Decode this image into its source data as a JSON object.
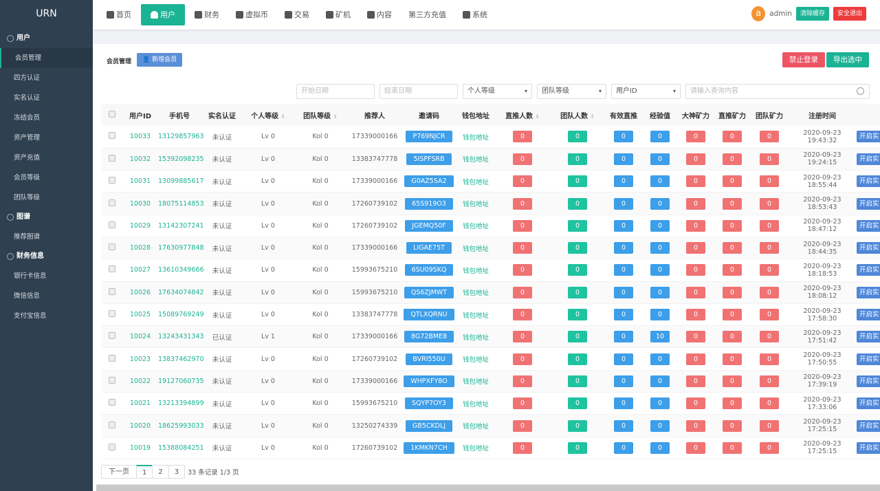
{
  "app": {
    "logo": "URN"
  },
  "sidebar": {
    "sections": [
      {
        "label": "用户",
        "items": [
          "会员管理",
          "四方认证",
          "实名认证",
          "冻结会员",
          "资产管理",
          "资产充值",
          "会员等级",
          "团队等级"
        ]
      },
      {
        "label": "图谱",
        "items": [
          "推荐图谱"
        ]
      },
      {
        "label": "财务信息",
        "items": [
          "银行卡信息",
          "微信信息",
          "支付宝信息"
        ]
      }
    ],
    "active": "会员管理"
  },
  "topnav": {
    "items": [
      {
        "label": "首页",
        "icon": "home-icon"
      },
      {
        "label": "用户",
        "icon": "user-icon"
      },
      {
        "label": "财务",
        "icon": "yen-icon"
      },
      {
        "label": "虚拟币",
        "icon": "database-icon"
      },
      {
        "label": "交易",
        "icon": "exchange-icon"
      },
      {
        "label": "矿机",
        "icon": "server-icon"
      },
      {
        "label": "内容",
        "icon": "document-icon"
      },
      {
        "label": "第三方充值",
        "icon": ""
      },
      {
        "label": "系统",
        "icon": "gear-icon"
      }
    ],
    "active": "用户"
  },
  "user": {
    "avatar": "a",
    "name": "admin",
    "clear_cache": "清除缓存",
    "logout": "安全退出"
  },
  "page": {
    "title": "会员管理",
    "add_button": "新增会员",
    "ban_button": "禁止登录",
    "export_button": "导出选中"
  },
  "filters": {
    "start_date": "开始日期",
    "end_date": "结束日期",
    "personal_level": "个人等级",
    "team_level": "团队等级",
    "field": "用户ID",
    "search_placeholder": "请输入查询内容"
  },
  "table": {
    "headers": [
      "用户ID",
      "手机号",
      "实名认证",
      "个人等级",
      "团队等级",
      "推荐人",
      "邀请码",
      "钱包地址",
      "直推人数",
      "团队人数",
      "有效直推",
      "经验值",
      "大神矿力",
      "直推矿力",
      "团队矿力",
      "注册时间",
      ""
    ],
    "rows": [
      [
        "10033",
        "13129857963",
        "未认证",
        "Lv 0",
        "Kol 0",
        "17339000166",
        "P769NJCR",
        "钱包地址",
        "0",
        "0",
        "0",
        "0",
        "0",
        "0",
        "0",
        "2020-09-23 19:43:32",
        "开启实"
      ],
      [
        "10032",
        "15392098235",
        "未认证",
        "Lv 0",
        "Kol 0",
        "13383747778",
        "5ISPFSRB",
        "钱包地址",
        "0",
        "0",
        "0",
        "0",
        "0",
        "0",
        "0",
        "2020-09-23 19:24:15",
        "开启实"
      ],
      [
        "10031",
        "13099885617",
        "未认证",
        "Lv 0",
        "Kol 0",
        "17339000166",
        "G0AZ5SA2",
        "钱包地址",
        "0",
        "0",
        "0",
        "0",
        "0",
        "0",
        "0",
        "2020-09-23 18:55:44",
        "开启实"
      ],
      [
        "10030",
        "18075114853",
        "未认证",
        "Lv 0",
        "Kol 0",
        "17260739102",
        "65S919O3",
        "钱包地址",
        "0",
        "0",
        "0",
        "0",
        "0",
        "0",
        "0",
        "2020-09-23 18:53:43",
        "开启实"
      ],
      [
        "10029",
        "13142307241",
        "未认证",
        "Lv 0",
        "Kol 0",
        "17260739102",
        "JGEMQ50F",
        "钱包地址",
        "0",
        "0",
        "0",
        "0",
        "0",
        "0",
        "0",
        "2020-09-23 18:47:12",
        "开启实"
      ],
      [
        "10028",
        "17630977848",
        "未认证",
        "Lv 0",
        "Kol 0",
        "17339000166",
        "LIGAE75T",
        "钱包地址",
        "0",
        "0",
        "0",
        "0",
        "0",
        "0",
        "0",
        "2020-09-23 18:44:35",
        "开启实"
      ],
      [
        "10027",
        "13610349666",
        "未认证",
        "Lv 0",
        "Kol 0",
        "15993675210",
        "6SU09SKQ",
        "钱包地址",
        "0",
        "0",
        "0",
        "0",
        "0",
        "0",
        "0",
        "2020-09-23 18:18:53",
        "开启实"
      ],
      [
        "10026",
        "17634074842",
        "未认证",
        "Lv 0",
        "Kol 0",
        "15993675210",
        "QS6ZJMWT",
        "钱包地址",
        "0",
        "0",
        "0",
        "0",
        "0",
        "0",
        "0",
        "2020-09-23 18:08:12",
        "开启实"
      ],
      [
        "10025",
        "15089769249",
        "未认证",
        "Lv 0",
        "Kol 0",
        "13383747778",
        "QTLXQRNU",
        "钱包地址",
        "0",
        "0",
        "0",
        "0",
        "0",
        "0",
        "0",
        "2020-09-23 17:58:30",
        "开启实"
      ],
      [
        "10024",
        "13243431343",
        "已认证",
        "Lv 1",
        "Kol 0",
        "17339000166",
        "8G72BME8",
        "钱包地址",
        "0",
        "0",
        "0",
        "10",
        "0",
        "0",
        "0",
        "2020-09-23 17:51:42",
        "开启实"
      ],
      [
        "10023",
        "13837462970",
        "未认证",
        "Lv 0",
        "Kol 0",
        "17260739102",
        "BVRI550U",
        "钱包地址",
        "0",
        "0",
        "0",
        "0",
        "0",
        "0",
        "0",
        "2020-09-23 17:50:55",
        "开启实"
      ],
      [
        "10022",
        "19127060735",
        "未认证",
        "Lv 0",
        "Kol 0",
        "17339000166",
        "WHPXFY8O",
        "钱包地址",
        "0",
        "0",
        "0",
        "0",
        "0",
        "0",
        "0",
        "2020-09-23 17:39:19",
        "开启实"
      ],
      [
        "10021",
        "13213394899",
        "未认证",
        "Lv 0",
        "Kol 0",
        "15993675210",
        "SQYP7OY3",
        "钱包地址",
        "0",
        "0",
        "0",
        "0",
        "0",
        "0",
        "0",
        "2020-09-23 17:33:06",
        "开启实"
      ],
      [
        "10020",
        "18625993033",
        "未认证",
        "Lv 0",
        "Kol 0",
        "13250274339",
        "GB5CKDLJ",
        "钱包地址",
        "0",
        "0",
        "0",
        "0",
        "0",
        "0",
        "0",
        "2020-09-23 17:25:15",
        "开启实"
      ],
      [
        "10019",
        "15388084251",
        "未认证",
        "Lv 0",
        "Kol 0",
        "17260739102",
        "1KMKN7CH",
        "钱包地址",
        "0",
        "0",
        "0",
        "0",
        "0",
        "0",
        "0",
        "2020-09-23 17:25:15",
        "开启实"
      ]
    ]
  },
  "pagination": {
    "next": "下一页",
    "pages": [
      "1",
      "2",
      "3"
    ],
    "current": "1",
    "info": "33 条记录 1/3 页"
  },
  "colors": {
    "accent": "#1ab394",
    "blue": "#3d9ee9",
    "red": "#f07273",
    "teal": "#1fc3a0",
    "sidebar": "#2f4050"
  }
}
